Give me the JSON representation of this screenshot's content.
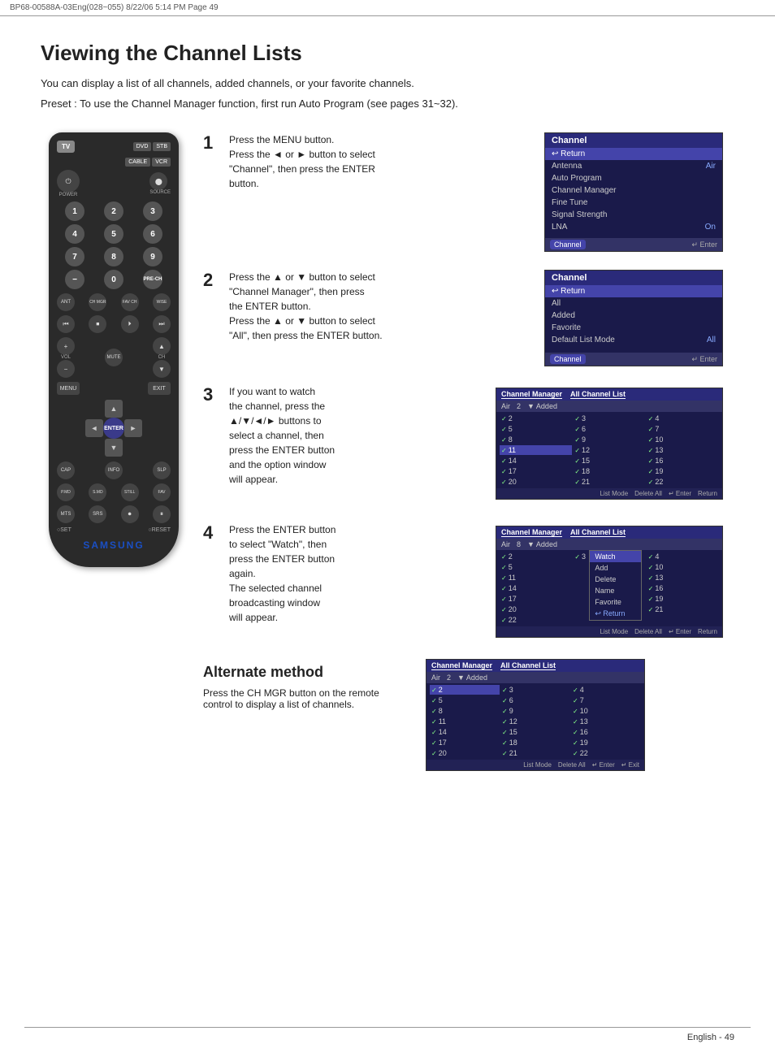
{
  "header": {
    "left": "BP68-00588A-03Eng(028~055)   8/22/06  5:14 PM   Page  49",
    "right": ""
  },
  "page": {
    "title": "Viewing the Channel Lists",
    "intro": "You can display a list of all channels, added channels, or your favorite channels.",
    "preset": "Preset : To use the Channel Manager function, first run Auto Program (see pages 31~32)."
  },
  "steps": [
    {
      "num": "1",
      "text1": "Press the MENU button.",
      "text2": "Press the ◄ or ► button to select",
      "text3": "\"Channel\", then press the ENTER",
      "text4": "button."
    },
    {
      "num": "2",
      "text1": "Press the ▲ or ▼ button to select",
      "text2": "\"Channel Manager\", then press",
      "text3": "the ENTER button.",
      "text4": "Press the ▲ or ▼ button to select",
      "text5": "\"All\", then press the ENTER button."
    },
    {
      "num": "3",
      "text1": "If you want to watch",
      "text2": "the channel, press the",
      "text3": "▲/▼/◄/► buttons to",
      "text4": "select a channel, then",
      "text5": "press the ENTER button",
      "text6": "and the option window",
      "text7": "will appear."
    },
    {
      "num": "4",
      "text1": "Press the ENTER button",
      "text2": "to select \"Watch\", then",
      "text3": "press the ENTER button",
      "text4": "again.",
      "text5": "The selected channel",
      "text6": "broadcasting window",
      "text7": "will appear."
    }
  ],
  "alt_method": {
    "title": "Alternate method",
    "text": "Press the CH MGR button on the remote control to display a list of channels."
  },
  "menu1": {
    "title": "Channel",
    "items": [
      "↩ Return",
      "Antenna",
      "Auto Program",
      "Channel Manager",
      "Fine Tune",
      "Signal Strength",
      "LNA"
    ],
    "antenna_val": "Air",
    "lna_val": "On",
    "footer": "↵ Enter"
  },
  "menu2": {
    "title": "Channel",
    "items": [
      "↩ Return",
      "All",
      "Added",
      "Favorite",
      "Default List Mode"
    ],
    "default_val": "All",
    "footer": "↵ Enter"
  },
  "ch_manager": {
    "title": "Channel Manager",
    "tab": "All Channel List",
    "sub_air": "Air",
    "sub_num": "2",
    "sub_added": "▼ Added",
    "footer_items": [
      "List Mode",
      "Delete All",
      "↵ Enter",
      "Return"
    ]
  },
  "footer": {
    "text": "English - 49"
  },
  "remote": {
    "tv": "TV",
    "dvd": "DVD",
    "stb": "STB",
    "cable": "CABLE",
    "vcr": "VCR",
    "power": "POWER",
    "source": "SOURCE",
    "samsung": "SAMSUNG"
  }
}
